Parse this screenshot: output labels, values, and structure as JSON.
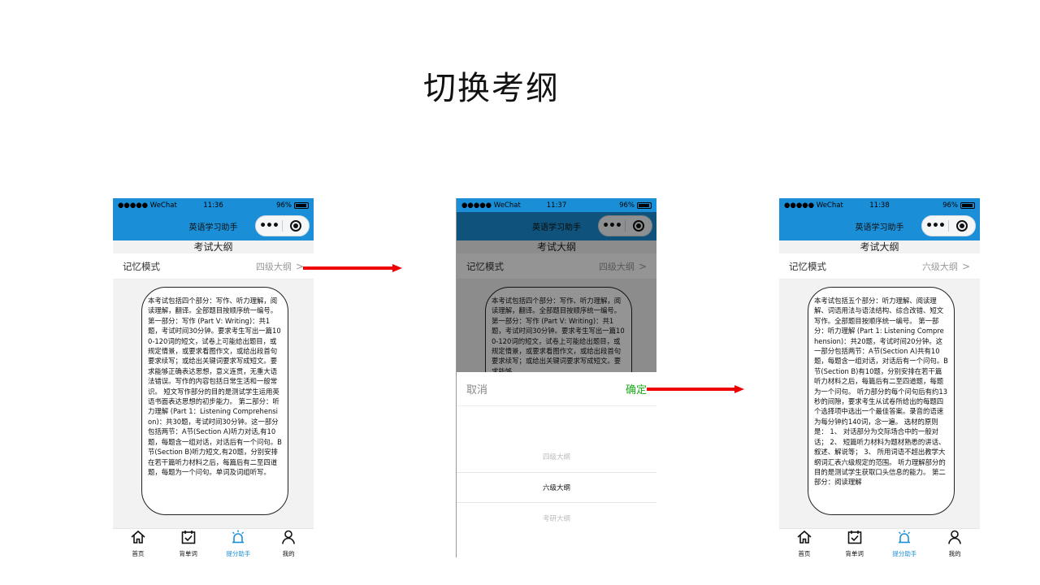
{
  "slide": {
    "title": "切换考纲"
  },
  "status_bar": {
    "carrier": "●●●●● WeChat",
    "battery": "96%"
  },
  "phones": [
    {
      "time": "11:36",
      "nav_title": "英语学习助手",
      "page_title": "考试大纲",
      "mode_label": "记忆模式",
      "mode_value": "四级大纲",
      "syllabus_text": "本考试包括四个部分：写作、听力理解，阅读理解，翻译。全部题目按顺序统一编号。第一部分：写作 (Part Ⅴ: Writing)：共1题，考试时间30分钟。要求考生写出一篇100-120词的短文，试卷上可能给出题目，或规定情景，或要求看图作文，或给出段首句要求续写；或给出关键词要求写成短文。要求能够正确表达思想，意义连贯，无重大语法错误。写作的内容包括日常生活和一般常识。 短文写作部分的目的是测试学生运用英语书面表达思想的初步能力。 第二部分：听力理解 (Part 1：Listening Comprehension)：共30题，考试时间30分钟。这一部分包括两节：A节(Section A)听力对话,有10题，每题含一组对话，对话后有一个问句。B节(Section B)听力短文,有20题，分别安排在若干篇听力材料之后，每篇后有二至四道题，每题为一个问句。单词及词组听写。"
    },
    {
      "time": "11:37",
      "nav_title": "英语学习助手",
      "page_title": "考试大纲",
      "mode_label": "记忆模式",
      "mode_value": "四级大纲",
      "syllabus_text": "本考试包括四个部分：写作、听力理解，阅读理解，翻译。全部题目按顺序统一编号。第一部分：写作 (Part Ⅴ: Writing)：共1题，考试时间30分钟。要求考生写出一篇100-120词的短文，试卷上可能给出题目，或规定情景，或要求看图作文，或给出段首句要求续写；或给出关键词要求写成短文。要求能够",
      "picker": {
        "cancel": "取消",
        "confirm": "确定",
        "options": [
          "四级大纲",
          "六级大纲",
          "考研大纲"
        ],
        "selected_index": 1
      }
    },
    {
      "time": "11:38",
      "nav_title": "英语学习助手",
      "page_title": "考试大纲",
      "mode_label": "记忆模式",
      "mode_value": "六级大纲",
      "syllabus_text": "本考试包括五个部分：听力理解、阅读理解、词语用法与语法结构、综合改错、短文写作。全部题目按顺序统一编号。 第一部分：听力理解 (Part 1: Listening Comprehension)：共20题，考试时间20分钟。这一部分包括两节：A节(Section A)共有10题，每题含一组对话，对话后有一个问句。B节(Section B)有10题，分别安排在若干篇听力材料之后，每篇后有二至四道题，每题为一个问句。 听力部分的每个问句后有约13秒的间隙，要求考生从试卷所给出的每题四个选择项中选出一个最佳答案。录音的语速为每分钟约140词，念一遍。 选材的原则是： 1、 对话部分为交际场合中的一般对话； 2、 短篇听力材料为题材熟悉的讲话、叙述、解说等； 3、 所用词语不超出教学大纲词汇表六级规定的范围。 听力理解部分的目的是测试学生获取口头信息的能力。 第二部分：阅读理解"
    }
  ],
  "tabbar": {
    "items": [
      {
        "label": "首页",
        "icon": "home-icon"
      },
      {
        "label": "背单词",
        "icon": "calendar-check-icon"
      },
      {
        "label": "提分助手",
        "icon": "alarm-icon"
      },
      {
        "label": "我的",
        "icon": "user-icon"
      }
    ],
    "active_index": 2
  },
  "colors": {
    "nav_blue": "#1a8fd8",
    "confirm_green": "#1aad19",
    "arrow_red": "#ee0000"
  }
}
